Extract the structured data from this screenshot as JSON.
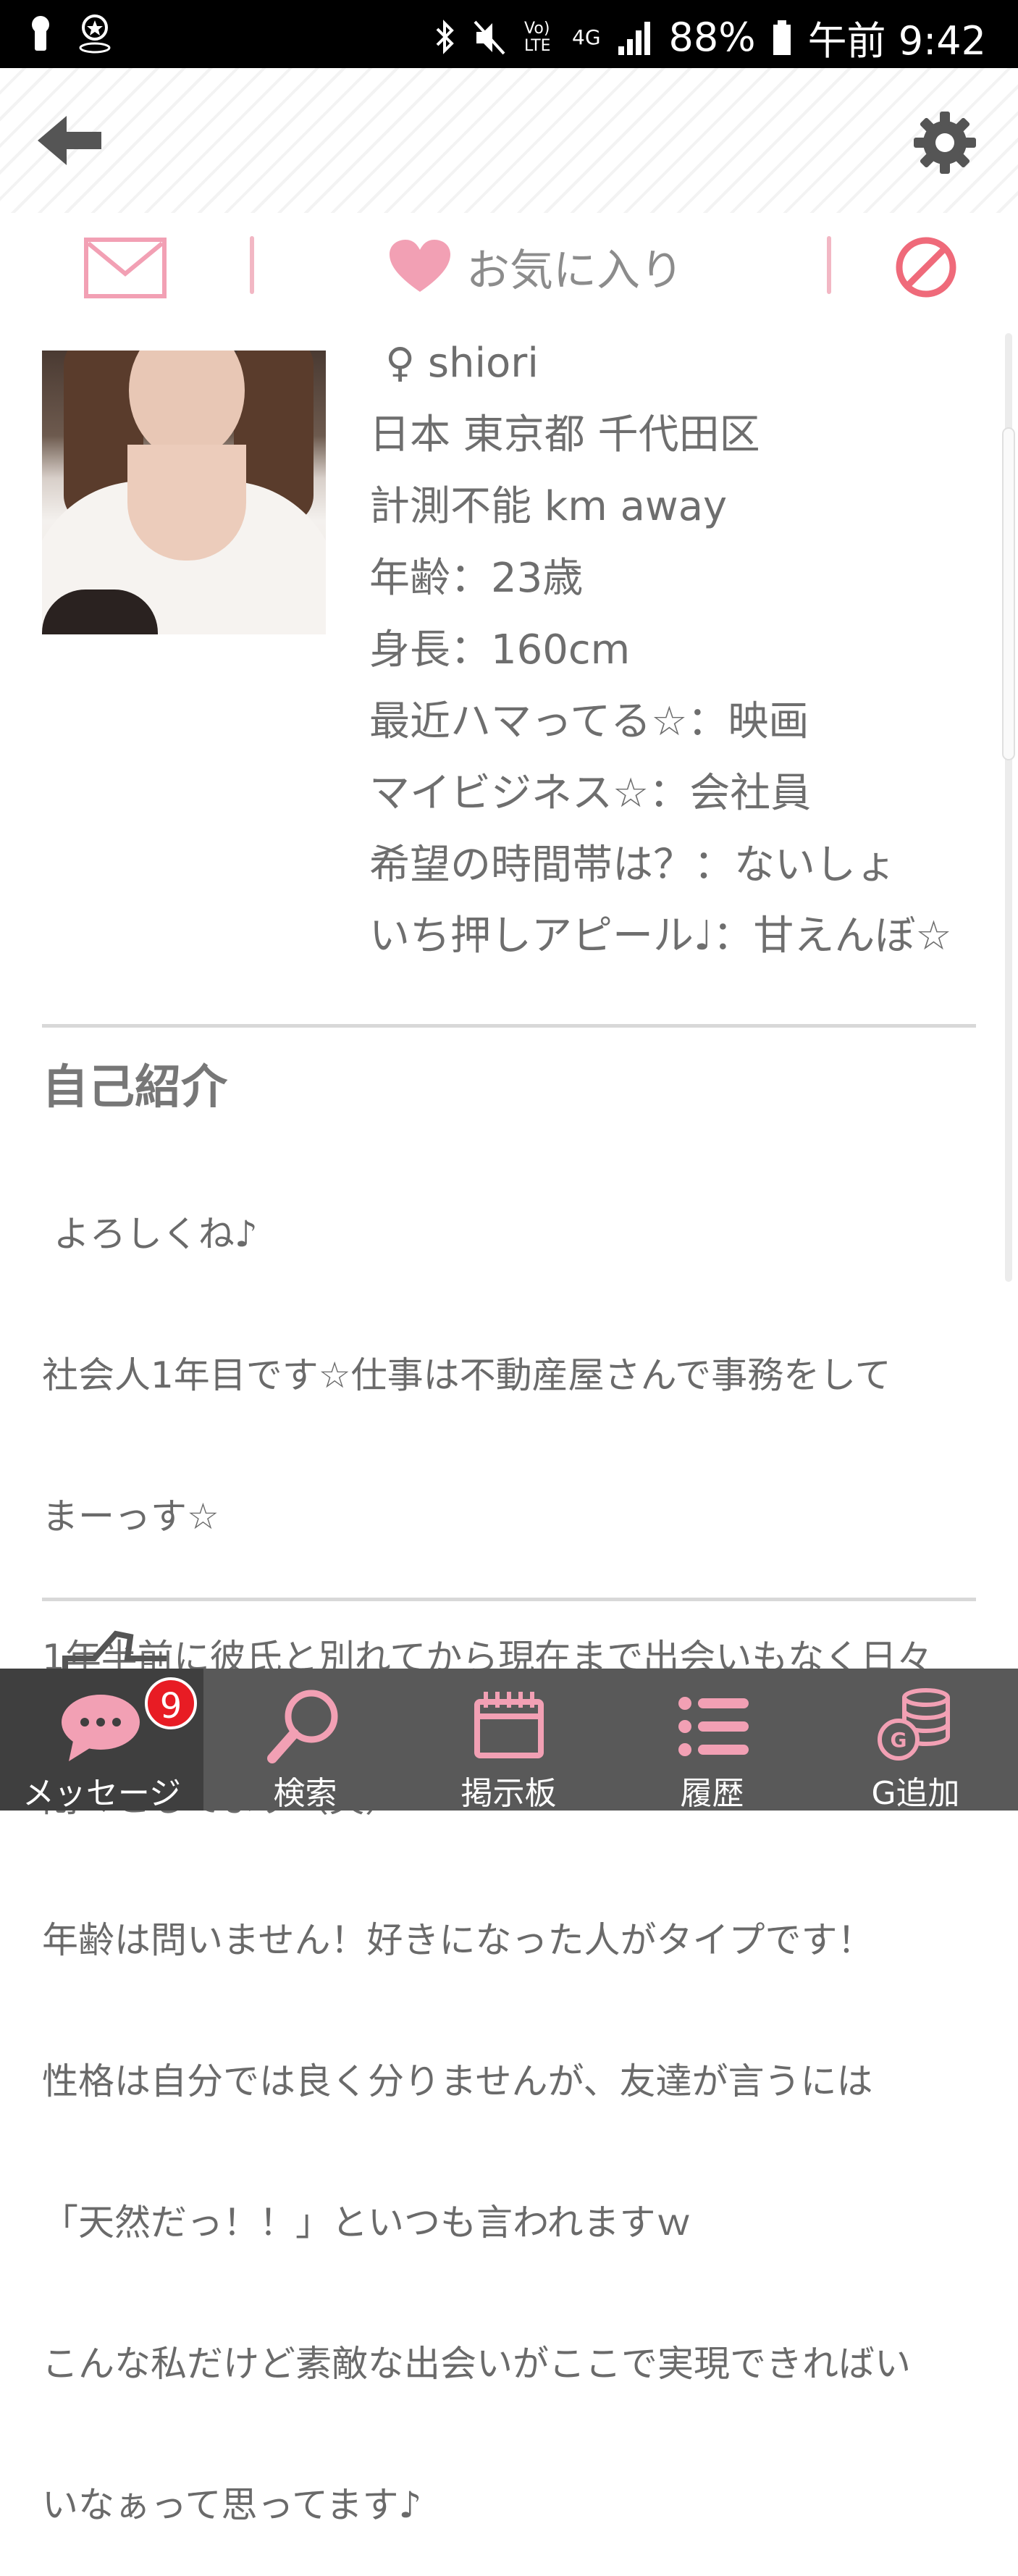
{
  "status_bar": {
    "battery": "88%",
    "time": "午前 9:42",
    "network": "4G",
    "lte": "Vo) LTE"
  },
  "action_bar": {
    "favorite_label": "お気に入り"
  },
  "profile": {
    "name": "♀ shiori",
    "location": "日本 東京都 千代田区",
    "distance": "計測不能 km away",
    "age": "年齢：23歳",
    "height": "身長：160cm",
    "hobby": "最近ハマってる☆：映画",
    "business": "マイビジネス☆：会社員",
    "time_pref": "希望の時間帯は？：ないしょ",
    "appeal": "いち押しアピール♩：甘えんぼ☆"
  },
  "intro": {
    "title": "自己紹介",
    "lines": [
      " よろしくね♪",
      "社会人1年目です☆仕事は不動産屋さんで事務をして",
      "まーっす☆",
      "1年半前に彼氏と別れてから現在まで出会いもなく日々",
      "悶々としてます（笑）",
      "年齢は問いません！好きになった人がタイプです！",
      "性格は自分では良く分りませんが、友達が言うには",
      "「天然だっ！！」といつも言われますｗ",
      "こんな私だけど素敵な出会いがここで実現できればい",
      "いなぁって思ってます♪"
    ]
  },
  "bottom_nav": {
    "items": [
      {
        "label": "メッセージ",
        "icon": "chat-bubble-icon",
        "badge": "9"
      },
      {
        "label": "検索",
        "icon": "search-icon"
      },
      {
        "label": "掲示板",
        "icon": "board-icon"
      },
      {
        "label": "履歴",
        "icon": "list-icon"
      },
      {
        "label": "G追加",
        "icon": "coins-icon"
      }
    ]
  },
  "colors": {
    "accent_pink": "#f2a0b4",
    "nav_bg": "#595959",
    "nav_active_bg": "#3f3f3f",
    "badge_red": "#e81c24"
  }
}
